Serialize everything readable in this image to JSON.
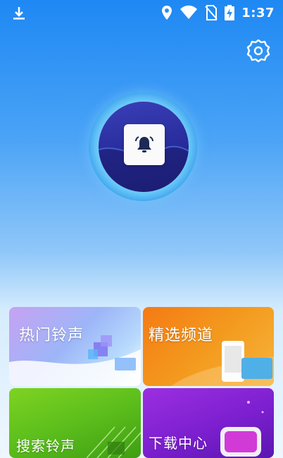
{
  "status_bar": {
    "time": "1:37",
    "icons": [
      "download-icon",
      "location-icon",
      "wifi-icon",
      "no-sim-icon",
      "battery-charging-icon"
    ]
  },
  "header": {
    "settings_icon": "gear-icon"
  },
  "hero": {
    "icon": "bell-icon"
  },
  "tiles": [
    {
      "label": "热门铃声",
      "color": "#9db5f8"
    },
    {
      "label": "精选频道",
      "color": "#f57a14"
    },
    {
      "label": "搜索铃声",
      "color": "#5cbe1c"
    },
    {
      "label": "下载中心",
      "color": "#7c1fcf"
    }
  ]
}
